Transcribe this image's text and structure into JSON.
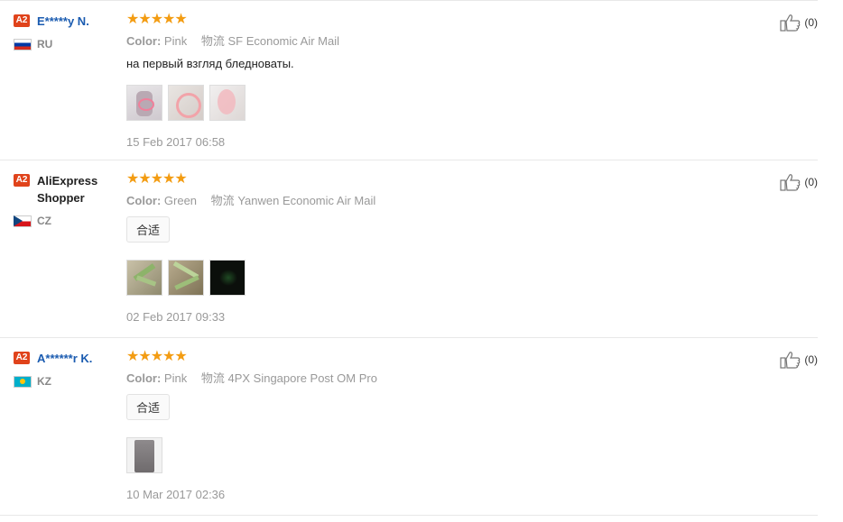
{
  "reviews": [
    {
      "badge": "A2",
      "name": "E*****y N.",
      "country": "RU",
      "stars": "★★★★★",
      "color_label": "Color:",
      "color_value": "Pink",
      "logistics_label": "物流",
      "logistics_value": "SF Economic Air Mail",
      "text": "на первый взгляд бледноваты.",
      "date": "15 Feb 2017 06:58",
      "helpful_count": "(0)"
    },
    {
      "badge": "A2",
      "name": "AliExpress Shopper",
      "country": "CZ",
      "stars": "★★★★★",
      "color_label": "Color:",
      "color_value": "Green",
      "logistics_label": "物流",
      "logistics_value": "Yanwen Economic Air Mail",
      "tag": "合适",
      "date": "02 Feb 2017 09:33",
      "helpful_count": "(0)"
    },
    {
      "badge": "A2",
      "name": "A******r K.",
      "country": "KZ",
      "stars": "★★★★★",
      "color_label": "Color:",
      "color_value": "Pink",
      "logistics_label": "物流",
      "logistics_value": "4PX Singapore Post OM Pro",
      "tag": "合适",
      "date": "10 Mar 2017 02:36",
      "helpful_count": "(0)"
    }
  ]
}
